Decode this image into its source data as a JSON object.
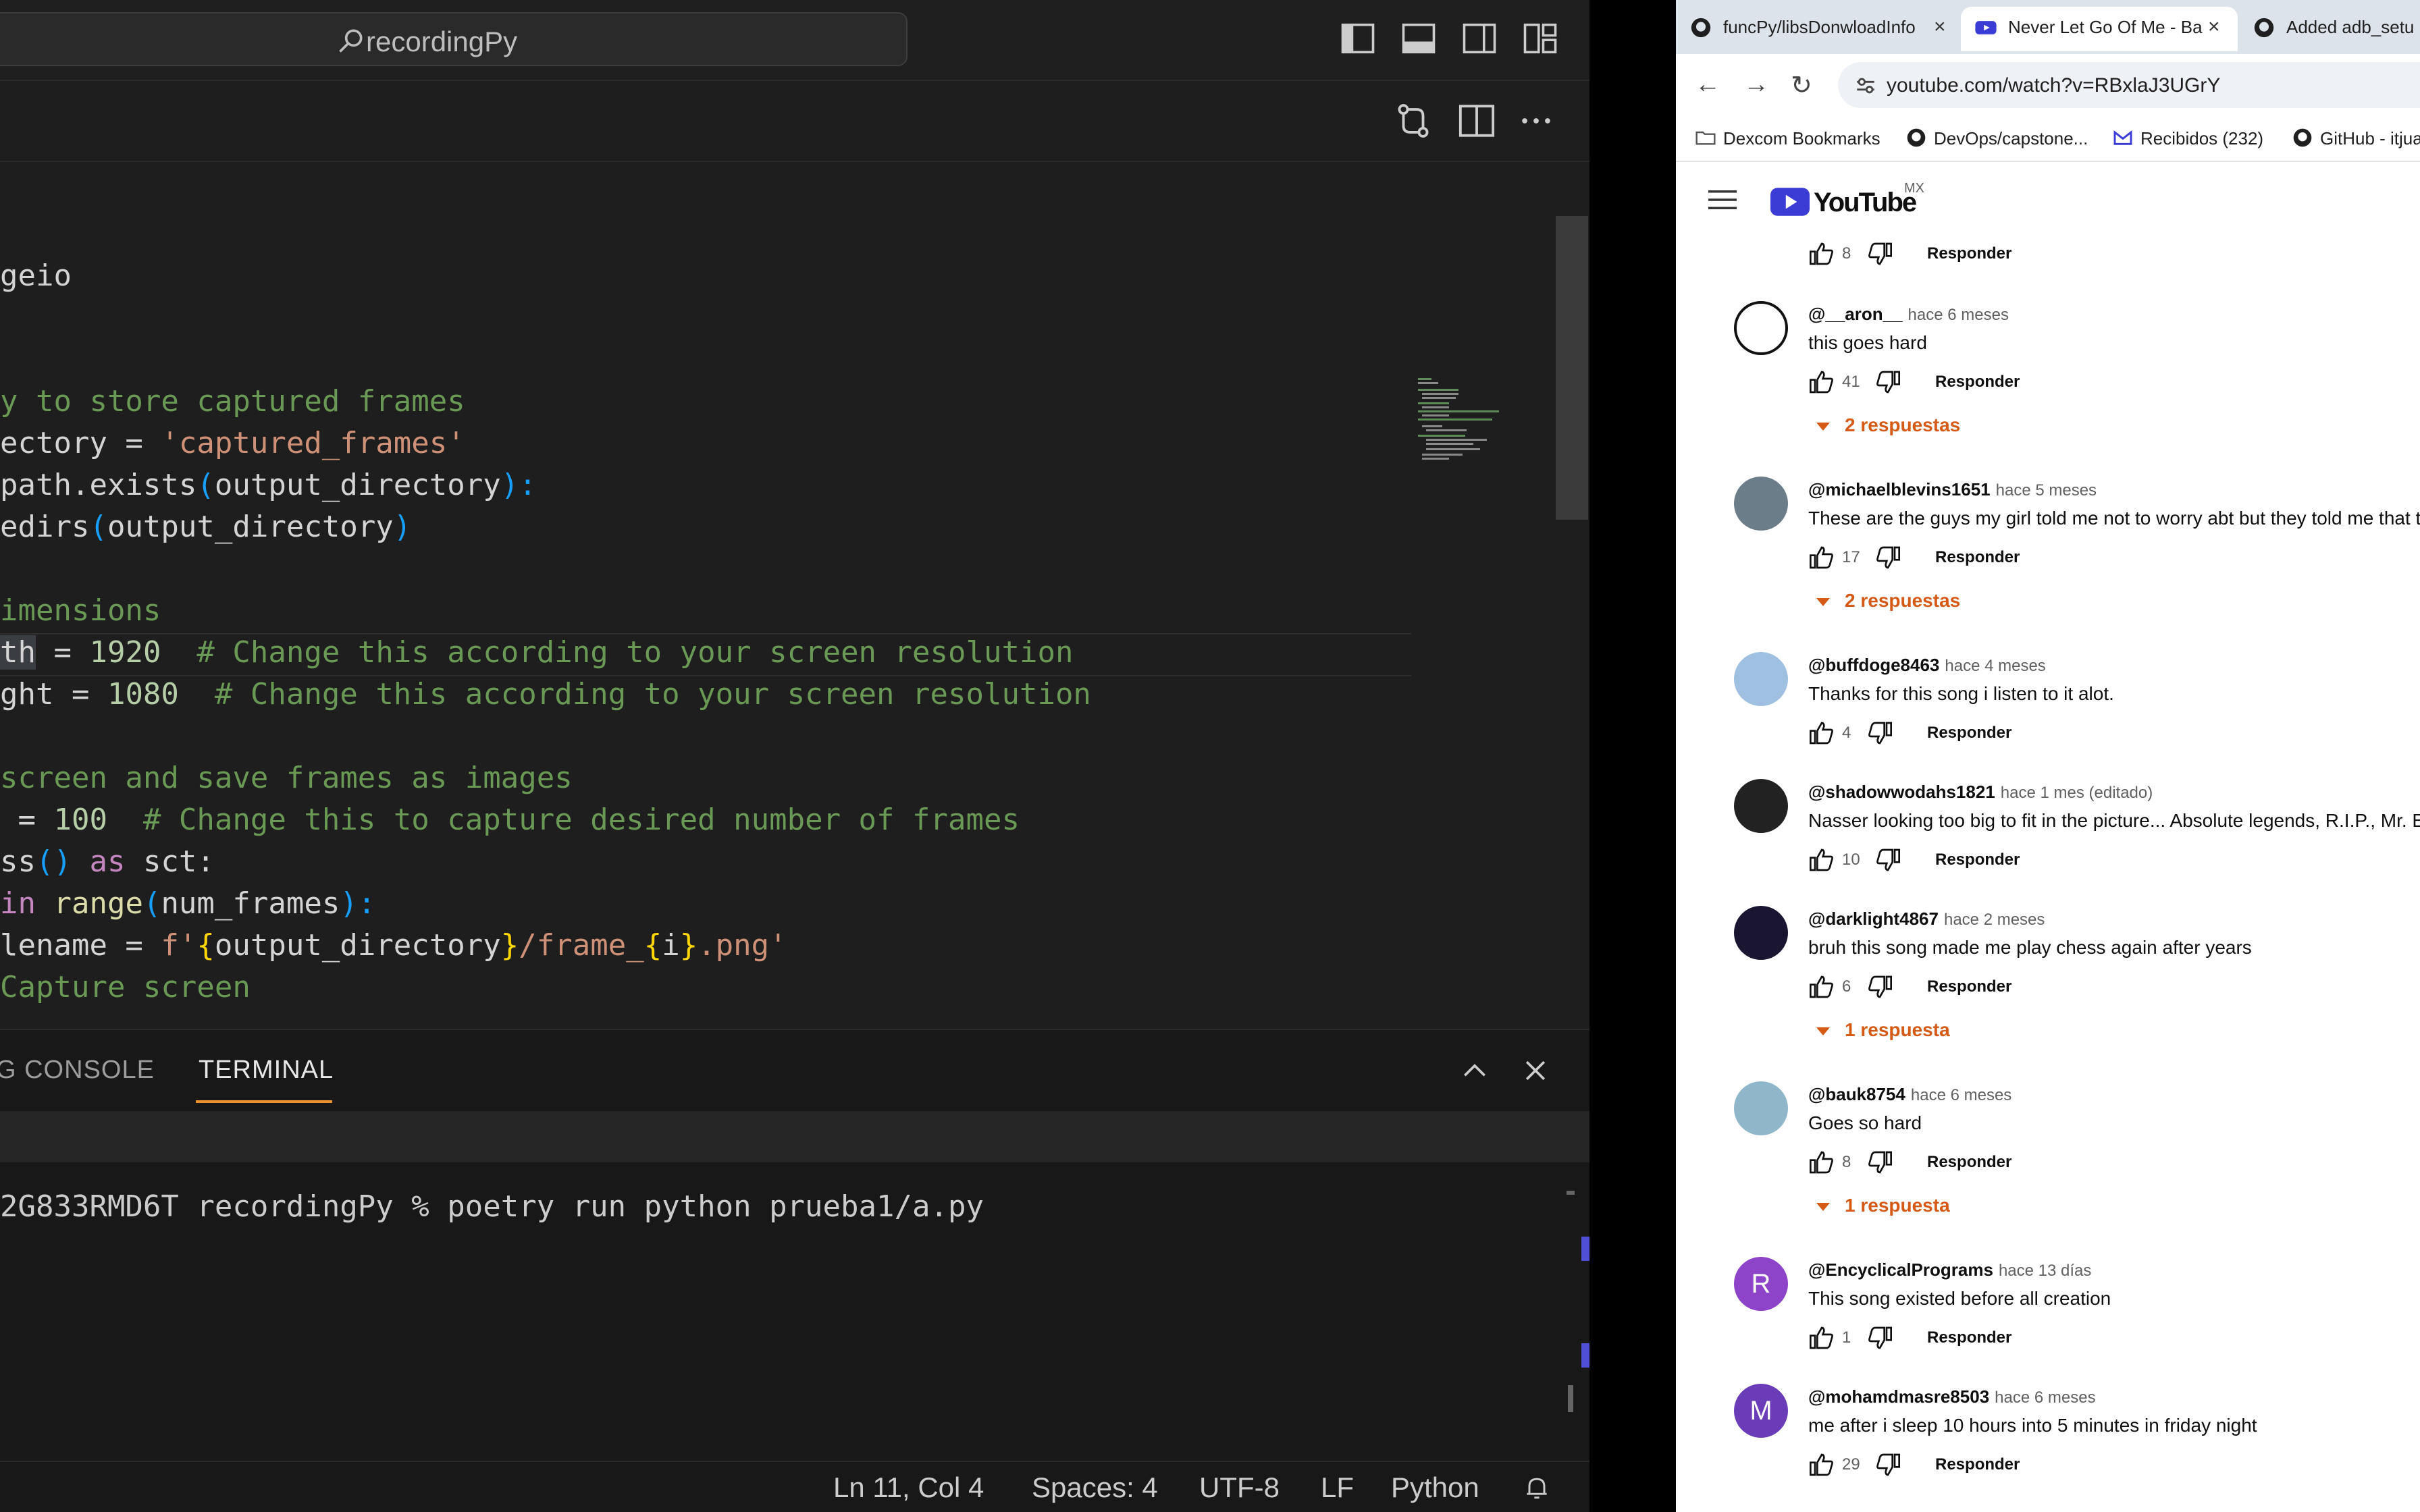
{
  "vscode": {
    "search_text": "recordingPy",
    "code_lines": [
      {
        "kind": "plain",
        "text": "geio"
      },
      {
        "kind": "comment",
        "text": "y to store captured frames"
      },
      {
        "kind": "assign_str",
        "a": "ectory = ",
        "b": "'captured_frames'"
      },
      {
        "kind": "path_exists",
        "a": "path.exists",
        "b": "(",
        "c": "output_directory",
        "d": "):"
      },
      {
        "kind": "makedirs",
        "a": "edirs",
        "b": "(",
        "c": "output_directory",
        "d": ")"
      },
      {
        "kind": "comment",
        "text": "imensions"
      },
      {
        "kind": "width",
        "a": "th",
        "b": " = ",
        "c": "1920",
        "d": "  # Change this according to your screen resolution"
      },
      {
        "kind": "height",
        "a": "ght = ",
        "b": "1080",
        "c": "  # Change this according to your screen resolution"
      },
      {
        "kind": "comment",
        "text": "screen and save frames as images"
      },
      {
        "kind": "numframes",
        "a": " = ",
        "b": "100",
        "c": "  # Change this to capture desired number of frames"
      },
      {
        "kind": "mss",
        "a": "ss",
        "b": "()",
        "c": " as ",
        "d": "sct:"
      },
      {
        "kind": "for",
        "a": "in ",
        "b": "range",
        "c": "(",
        "d": "num_frames",
        "e": "):"
      },
      {
        "kind": "fstring",
        "a": "lename = ",
        "b": "f'",
        "c": "{",
        "d": "output_directory",
        "e": "}",
        "f": "/frame_",
        "g": "{",
        "h": "i",
        "i": "}",
        "j": ".png'"
      },
      {
        "kind": "comment",
        "text": "Capture screen"
      }
    ],
    "panel_tabs": {
      "debug_console": "G CONSOLE",
      "terminal": "TERMINAL"
    },
    "terminal_line": "2G833RMD6T recordingPy % poetry run python prueba1/a.py",
    "status": {
      "position": "Ln 11, Col 4",
      "spaces": "Spaces: 4",
      "encoding": "UTF-8",
      "eol": "LF",
      "language": "Python"
    }
  },
  "browser": {
    "tabs": [
      {
        "title": "funcPy/libsDonwloadInfo"
      },
      {
        "title": "Never Let Go Of Me - Ba"
      },
      {
        "title": "Added adb_setu"
      }
    ],
    "url": "youtube.com/watch?v=RBxlaJ3UGrY",
    "bookmarks": [
      "Dexcom Bookmarks",
      "DevOps/capstone...",
      "Recibidos (232)",
      "GitHub - itjua"
    ],
    "youtube": {
      "logo_text": "YouTube",
      "region": "MX"
    },
    "reply_label": "Responder",
    "top_like_count": "8",
    "comments": [
      {
        "author": "@__aron__",
        "time": "hace 6 meses",
        "text": "this goes hard",
        "likes": "41",
        "replies": "2 respuestas",
        "avatar_color": "#ffffff"
      },
      {
        "author": "@michaelblevins1651",
        "time": "hace 5 meses",
        "text": "These are the guys my girl told me not to worry abt but they told me that t",
        "likes": "17",
        "replies": "2 respuestas",
        "avatar_color": "#6a7d89"
      },
      {
        "author": "@buffdoge8463",
        "time": "hace 4 meses",
        "text": "Thanks for this song i listen to it alot.",
        "likes": "4",
        "replies": "",
        "avatar_color": "#9fc0e0"
      },
      {
        "author": "@shadowwodahs1821",
        "time": "hace 1 mes (editado)",
        "text": "Nasser looking too big to fit in the picture... Absolute legends, R.I.P., Mr. E",
        "likes": "10",
        "replies": "",
        "avatar_color": "#222222"
      },
      {
        "author": "@darklight4867",
        "time": "hace 2 meses",
        "text": "bruh this song made me play chess again after years",
        "likes": "6",
        "replies": "1 respuesta",
        "avatar_color": "#1a1530"
      },
      {
        "author": "@bauk8754",
        "time": "hace 6 meses",
        "text": "Goes so hard",
        "likes": "8",
        "replies": "1 respuesta",
        "avatar_color": "#8fb7c9"
      },
      {
        "author": "@EncyclicalPrograms",
        "time": "hace 13 días",
        "text": "This song existed before all creation",
        "likes": "1",
        "replies": "",
        "avatar_color": "#8e44c8",
        "initial": "R"
      },
      {
        "author": "@mohamdmasre8503",
        "time": "hace 6 meses",
        "text": "me after i sleep 10 hours into 5 minutes in friday night",
        "likes": "29",
        "replies": "",
        "avatar_color": "#6a3cb8",
        "initial": "M"
      }
    ]
  }
}
